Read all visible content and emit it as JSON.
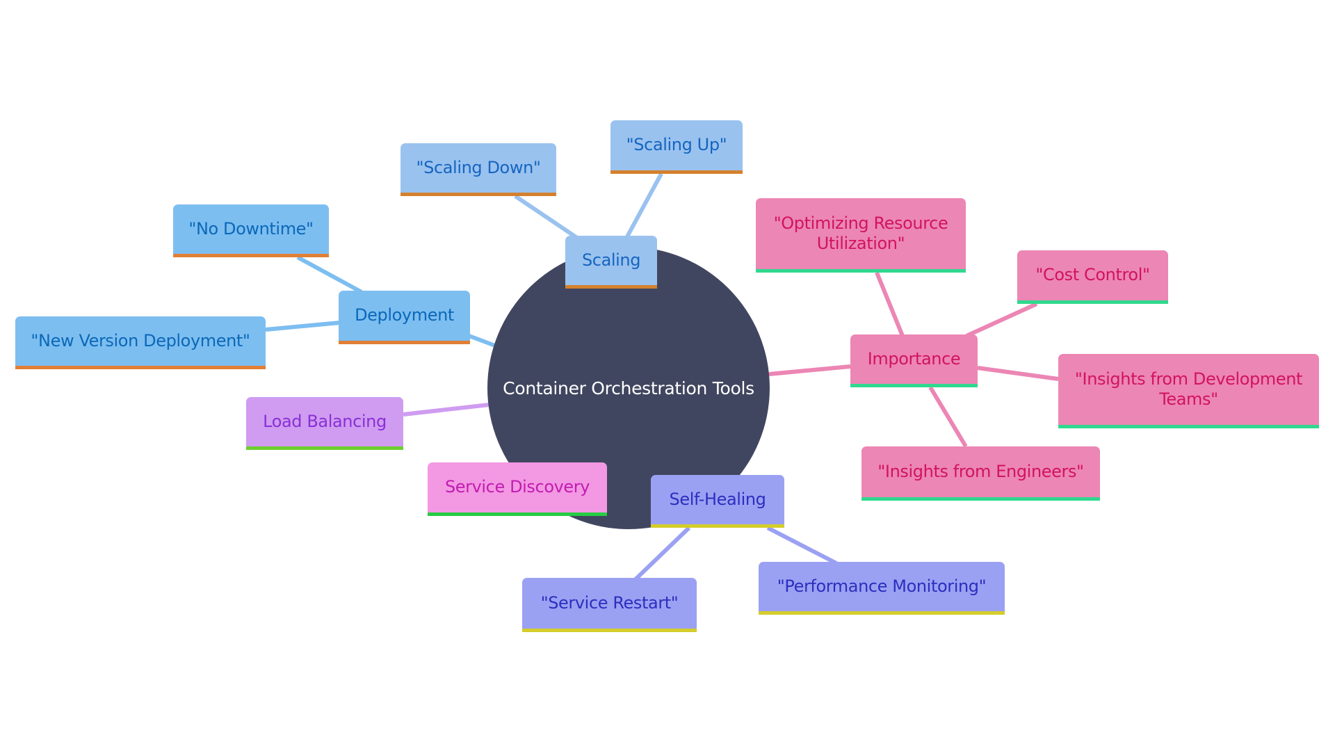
{
  "diagram": {
    "type": "mindmap",
    "root": {
      "label": "Container Orchestration Tools",
      "fill": "#414660",
      "text": "#ffffff"
    },
    "branches": [
      {
        "id": "scaling",
        "label": "Scaling",
        "fill": "#9ac2ef",
        "text": "#1565c0",
        "bar": "#d4812d",
        "edge": "#9ac2ef",
        "children": [
          {
            "id": "scaling-up",
            "label": "\"Scaling Up\""
          },
          {
            "id": "scaling-down",
            "label": "\"Scaling Down\""
          }
        ]
      },
      {
        "id": "deployment",
        "label": "Deployment",
        "fill": "#7dbef1",
        "text": "#0b68b7",
        "bar": "#e07f35",
        "edge": "#7dbef1",
        "children": [
          {
            "id": "no-downtime",
            "label": "\"No Downtime\""
          },
          {
            "id": "new-version-deployment",
            "label": "\"New Version Deployment\""
          }
        ]
      },
      {
        "id": "load-balancing",
        "label": "Load Balancing",
        "fill": "#cf9cf1",
        "text": "#8a2fd6",
        "bar": "#6cce2e",
        "edge": "#cf9cf1",
        "children": []
      },
      {
        "id": "service-discovery",
        "label": "Service Discovery",
        "fill": "#f398e3",
        "text": "#c21cb0",
        "bar": "#27cc44",
        "edge": "#f398e3",
        "children": []
      },
      {
        "id": "self-healing",
        "label": "Self-Healing",
        "fill": "#9ba1f2",
        "text": "#2a2fbf",
        "bar": "#d4cd2a",
        "edge": "#9ba1f2",
        "children": [
          {
            "id": "service-restart",
            "label": "\"Service Restart\""
          },
          {
            "id": "performance-monitoring",
            "label": "\"Performance Monitoring\""
          }
        ]
      },
      {
        "id": "importance",
        "label": "Importance",
        "fill": "#ec86b4",
        "text": "#d1135f",
        "bar": "#30d98e",
        "edge": "#ec86b4",
        "children": [
          {
            "id": "optimizing-resource-utilization",
            "label": "\"Optimizing Resource Utilization\""
          },
          {
            "id": "cost-control",
            "label": "\"Cost Control\""
          },
          {
            "id": "insights-dev-teams",
            "label": "\"Insights from Development Teams\""
          },
          {
            "id": "insights-engineers",
            "label": "\"Insights from Engineers\""
          }
        ]
      }
    ]
  }
}
